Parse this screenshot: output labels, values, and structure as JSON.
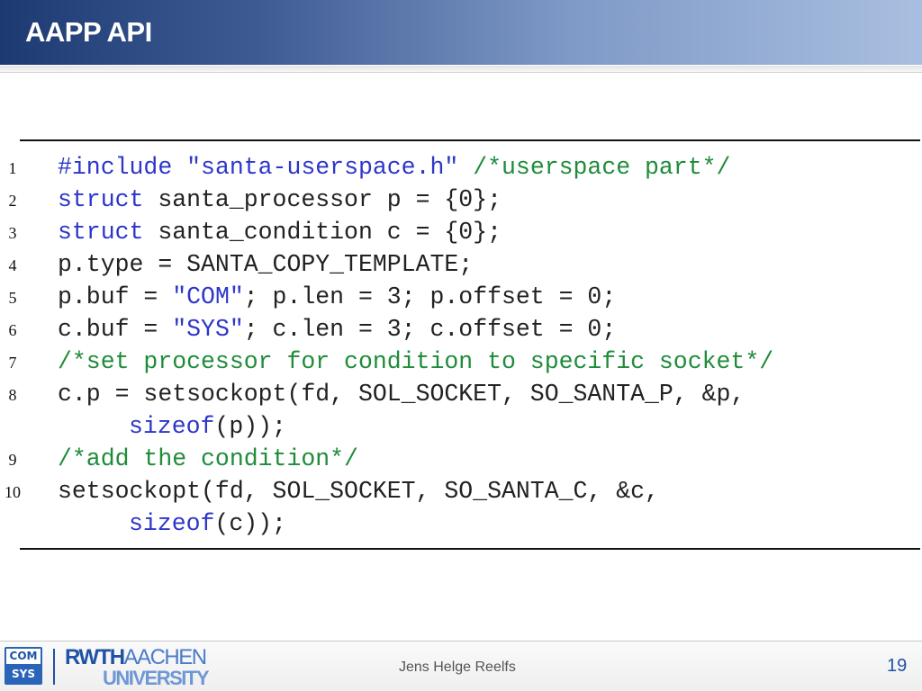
{
  "header": {
    "title": "AAPP API"
  },
  "code": {
    "lines": [
      {
        "number": "1",
        "tokens": [
          {
            "t": "#include",
            "k": "kw"
          },
          {
            "t": " "
          },
          {
            "t": "\"santa-userspace.h\"",
            "k": "str"
          },
          {
            "t": " "
          },
          {
            "t": "/*userspace part*/",
            "k": "com"
          }
        ]
      },
      {
        "number": "2",
        "tokens": [
          {
            "t": "struct",
            "k": "kw"
          },
          {
            "t": " santa_processor p = {0};"
          }
        ]
      },
      {
        "number": "3",
        "tokens": [
          {
            "t": "struct",
            "k": "kw"
          },
          {
            "t": " santa_condition c = {0};"
          }
        ]
      },
      {
        "number": "4",
        "tokens": [
          {
            "t": "p.type = SANTA_COPY_TEMPLATE;"
          }
        ]
      },
      {
        "number": "5",
        "tokens": [
          {
            "t": "p.buf = "
          },
          {
            "t": "\"COM\"",
            "k": "str"
          },
          {
            "t": "; p.len = 3; p.offset = 0;"
          }
        ]
      },
      {
        "number": "6",
        "tokens": [
          {
            "t": "c.buf = "
          },
          {
            "t": "\"SYS\"",
            "k": "str"
          },
          {
            "t": "; c.len = 3; c.offset = 0;"
          }
        ]
      },
      {
        "number": "7",
        "tokens": [
          {
            "t": "/*set processor for condition to specific socket*/",
            "k": "com"
          }
        ]
      },
      {
        "number": "8",
        "tokens": [
          {
            "t": "c.p = setsockopt(fd, SOL_SOCKET, SO_SANTA_P, &p,"
          }
        ]
      },
      {
        "number": "",
        "indent": true,
        "tokens": [
          {
            "t": "sizeof",
            "k": "kw"
          },
          {
            "t": "(p));"
          }
        ]
      },
      {
        "number": "9",
        "tokens": [
          {
            "t": "/*add the condition*/",
            "k": "com"
          }
        ]
      },
      {
        "number": "10",
        "tokens": [
          {
            "t": "setsockopt(fd, SOL_SOCKET, SO_SANTA_C, &c,"
          }
        ]
      },
      {
        "number": "",
        "indent": true,
        "tokens": [
          {
            "t": "sizeof",
            "k": "kw"
          },
          {
            "t": "(c));"
          }
        ]
      }
    ]
  },
  "footer": {
    "logo_comsys": {
      "top": "COM",
      "bottom": "SYS"
    },
    "logo_rwth": {
      "line1_bold": "RWTH",
      "line1_light": "AACHEN",
      "line2": "UNIVERSITY"
    },
    "author": "Jens Helge Reelfs",
    "page_number": "19"
  },
  "colors": {
    "keyword": "#2e36c9",
    "string": "#2e36c9",
    "comment": "#1f8c3a",
    "text": "#222222",
    "brand_blue": "#1f52a5"
  }
}
